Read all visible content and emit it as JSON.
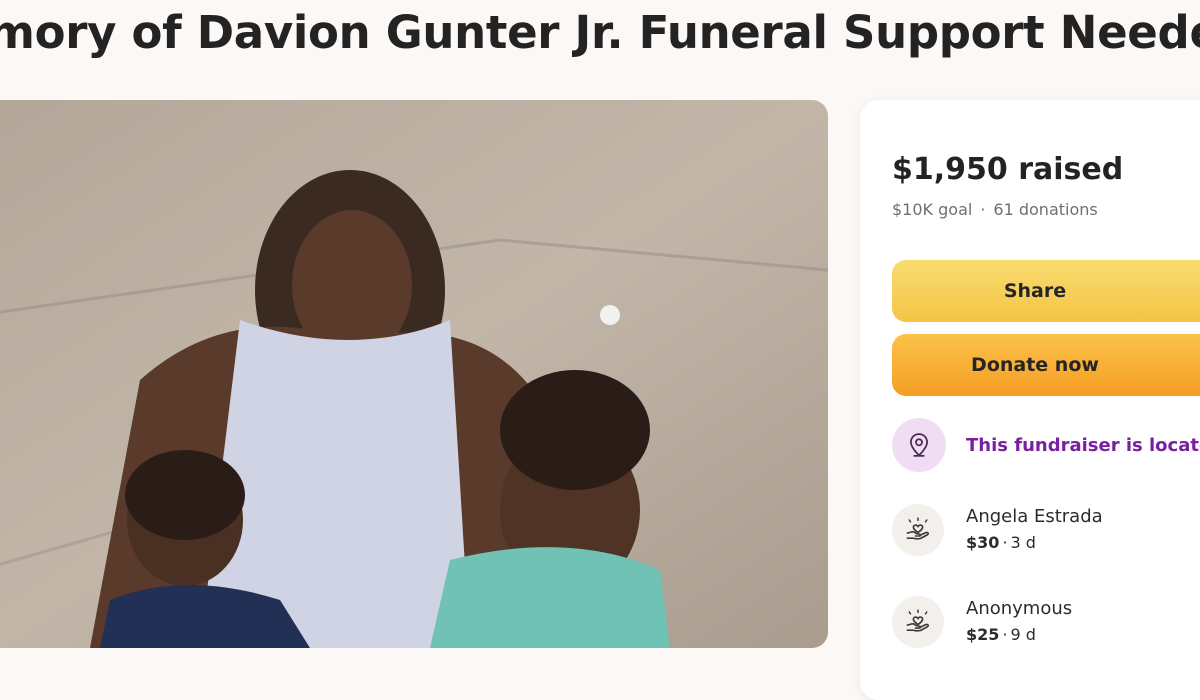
{
  "page": {
    "title": "mory of Davion Gunter Jr. Funeral Support Needed"
  },
  "hero": {
    "image_icon": "photo-icon"
  },
  "summary": {
    "raised": "$1,950 raised",
    "goal": "$10K goal",
    "separator": "·",
    "donations": "61 donations"
  },
  "buttons": {
    "share_label": "Share",
    "donate_label": "Donate now"
  },
  "location": {
    "icon": "location-pin-icon",
    "text": "This fundraiser is locate"
  },
  "donations_list": [
    {
      "icon": "heart-hand-icon",
      "name": "Angela Estrada",
      "amount": "$30",
      "separator": "·",
      "time": "3 d"
    },
    {
      "icon": "heart-hand-icon",
      "name": "Anonymous",
      "amount": "$25",
      "separator": "·",
      "time": "9 d"
    }
  ],
  "colors": {
    "page_background": "#fbf8f6",
    "share_button": "#f6cb50",
    "donate_button": "#f7ab2e",
    "location_text": "#7b1fa2",
    "location_icon_bg": "#f1ddf3"
  }
}
